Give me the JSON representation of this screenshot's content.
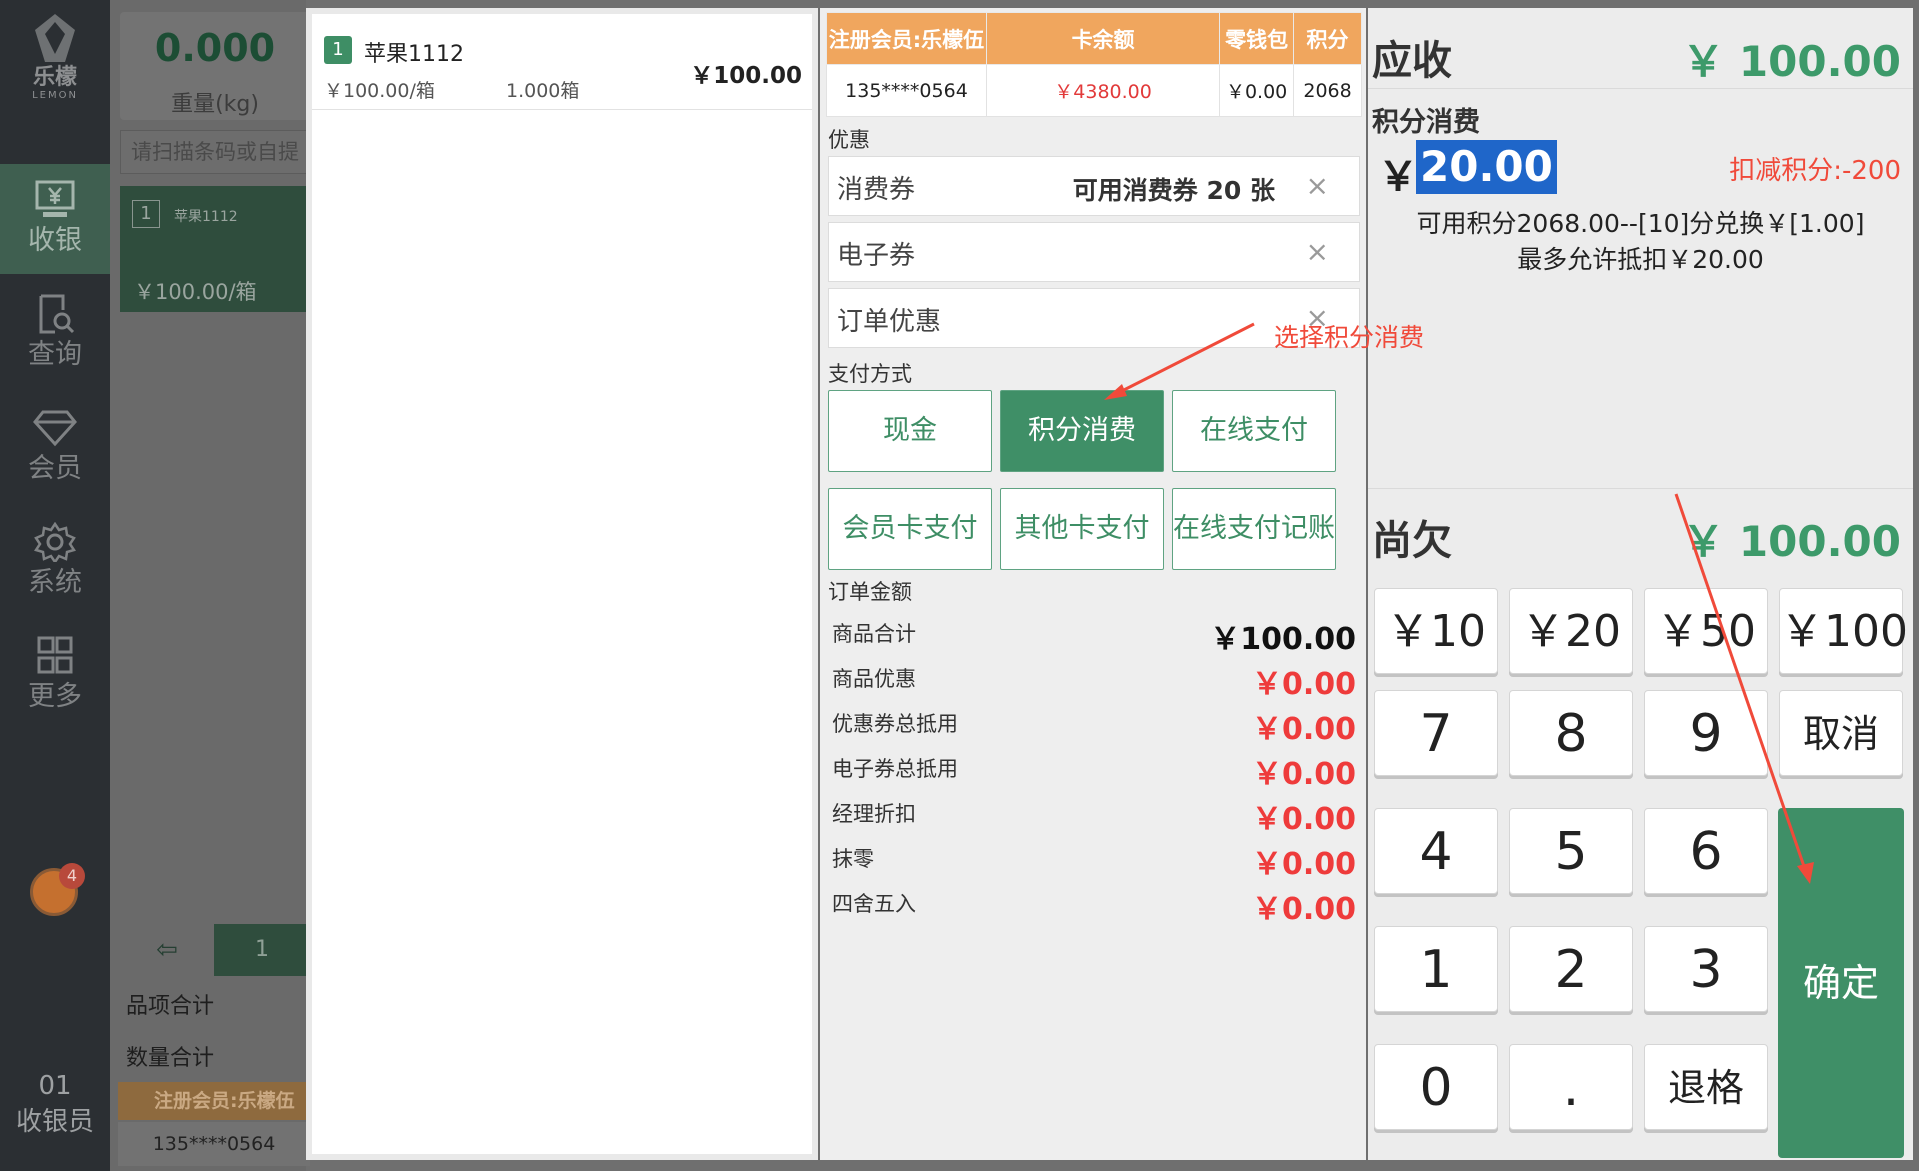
{
  "nav": {
    "brand_cn": "乐檬",
    "brand_en": "LEMON",
    "items": [
      {
        "label": "收银",
        "icon": "cash-register-icon"
      },
      {
        "label": "查询",
        "icon": "search-doc-icon"
      },
      {
        "label": "会员",
        "icon": "diamond-icon"
      },
      {
        "label": "系统",
        "icon": "gear-icon"
      },
      {
        "label": "更多",
        "icon": "grid-icon"
      }
    ],
    "notification_count": "4",
    "cashier_no": "01",
    "cashier_label": "收银员"
  },
  "background": {
    "weight_value": "0.000",
    "weight_label": "重量(kg)",
    "scan_placeholder": "请扫描条码或自提",
    "tile_index": "1",
    "tile_name": "苹果1112",
    "tile_price": "￥100.00/箱",
    "page_back": "⇦",
    "page_no": "1",
    "items_total_label": "品项合计",
    "qty_total_label": "数量合计",
    "member_name": "注册会员:乐檬伍",
    "member_phone": "135****0564"
  },
  "cart": {
    "items": [
      {
        "index": "1",
        "name": "苹果1112",
        "unit_price": "￥100.00/箱",
        "qty": "1.000箱",
        "amount": "￥100.00"
      }
    ]
  },
  "member": {
    "headers": [
      "注册会员:乐檬伍",
      "卡余额",
      "零钱包",
      "积分"
    ],
    "phone": "135****0564",
    "card_balance": "￥4380.00",
    "wallet": "￥0.00",
    "points": "2068"
  },
  "discounts": {
    "section_label": "优惠",
    "coupon_label": "消费券",
    "coupon_value": "可用消费券 20 张",
    "ecoupon_label": "电子券",
    "order_discount_label": "订单优惠",
    "clear_glyph": "×"
  },
  "payment": {
    "section_label": "支付方式",
    "methods": [
      "现金",
      "积分消费",
      "在线支付",
      "会员卡支付",
      "其他卡支付",
      "在线支付记账"
    ],
    "selected": "积分消费"
  },
  "order": {
    "section_label": "订单金额",
    "rows": [
      {
        "label": "商品合计",
        "value": "￥100.00"
      },
      {
        "label": "商品优惠",
        "value": "￥0.00"
      },
      {
        "label": "优惠券总抵用",
        "value": "￥0.00"
      },
      {
        "label": "电子券总抵用",
        "value": "￥0.00"
      },
      {
        "label": "经理折扣",
        "value": "￥0.00"
      },
      {
        "label": "抹零",
        "value": "￥0.00"
      },
      {
        "label": "四舍五入",
        "value": "￥0.00"
      }
    ]
  },
  "summary": {
    "receivable_label": "应收",
    "receivable_value": "￥ 100.00",
    "points_title": "积分消费",
    "yen": "￥",
    "points_amount": "20.00",
    "deduct_text": "扣减积分:-200",
    "avail_line1": "可用积分2068.00--[10]分兑换￥[1.00]",
    "avail_line2": "最多允许抵扣￥20.00",
    "owed_label": "尚欠",
    "owed_value": "￥ 100.00"
  },
  "keypad": {
    "quick": [
      "￥10",
      "￥20",
      "￥50",
      "￥100"
    ],
    "digits": [
      "7",
      "8",
      "9",
      "4",
      "5",
      "6",
      "1",
      "2",
      "3",
      "0",
      "."
    ],
    "cancel": "取消",
    "backspace": "退格",
    "confirm": "确定"
  },
  "annotation": {
    "text": "选择积分消费",
    "color": "#f04a3a"
  },
  "colors": {
    "accent_green": "#3f8f67",
    "header_orange": "#f0a65e",
    "alert_red": "#e23a3a"
  }
}
